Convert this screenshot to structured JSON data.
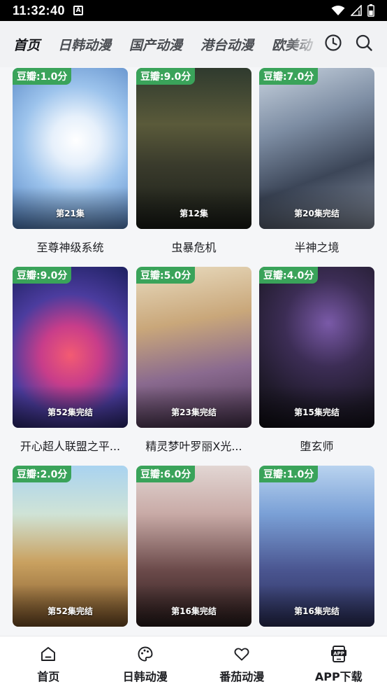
{
  "status_bar": {
    "time": "11:32:40",
    "notification_icon": "A"
  },
  "tabs": [
    {
      "label": "首页",
      "active": true
    },
    {
      "label": "日韩动漫",
      "active": false
    },
    {
      "label": "国产动漫",
      "active": false
    },
    {
      "label": "港台动漫",
      "active": false
    },
    {
      "label": "欧美动",
      "active": false
    }
  ],
  "toolbar_icons": [
    "history-icon",
    "search-icon"
  ],
  "cards": [
    {
      "score": "豆瓣:1.0分",
      "episode": "第21集",
      "title": "至尊神级系统",
      "palette": [
        "#cfe4f7",
        "#6fa0d8"
      ]
    },
    {
      "score": "豆瓣:9.0分",
      "episode": "第12集",
      "title": "虫暴危机",
      "palette": [
        "#3b4a3c",
        "#1e241d"
      ]
    },
    {
      "score": "豆瓣:7.0分",
      "episode": "第20集完结",
      "title": "半神之境",
      "palette": [
        "#a9b8c9",
        "#4c5a6e"
      ]
    },
    {
      "score": "豆瓣:9.0分",
      "episode": "第52集完结",
      "title": "开心超人联盟之平...",
      "palette": [
        "#4a3f9c",
        "#e44c6a"
      ]
    },
    {
      "score": "豆瓣:5.0分",
      "episode": "第23集完结",
      "title": "精灵梦叶罗丽X光...",
      "palette": [
        "#d7c4a0",
        "#8a6a8f"
      ]
    },
    {
      "score": "豆瓣:4.0分",
      "episode": "第15集完结",
      "title": "堕玄师",
      "palette": [
        "#3a2f4f",
        "#17131f"
      ]
    },
    {
      "score": "豆瓣:2.0分",
      "episode": "第52集完结",
      "title": "",
      "palette": [
        "#9cc5e8",
        "#d9a85a"
      ]
    },
    {
      "score": "豆瓣:6.0分",
      "episode": "第16集完结",
      "title": "",
      "palette": [
        "#d8c7c2",
        "#5a3f3e"
      ]
    },
    {
      "score": "豆瓣:1.0分",
      "episode": "第16集完结",
      "title": "",
      "palette": [
        "#7aa0d6",
        "#2b2f5a"
      ]
    }
  ],
  "bottom_nav": [
    {
      "label": "首页",
      "icon": "home-icon"
    },
    {
      "label": "日韩动漫",
      "icon": "palette-icon"
    },
    {
      "label": "番茄动漫",
      "icon": "heart-icon"
    },
    {
      "label": "APP下载",
      "icon": "app-download-icon"
    }
  ]
}
